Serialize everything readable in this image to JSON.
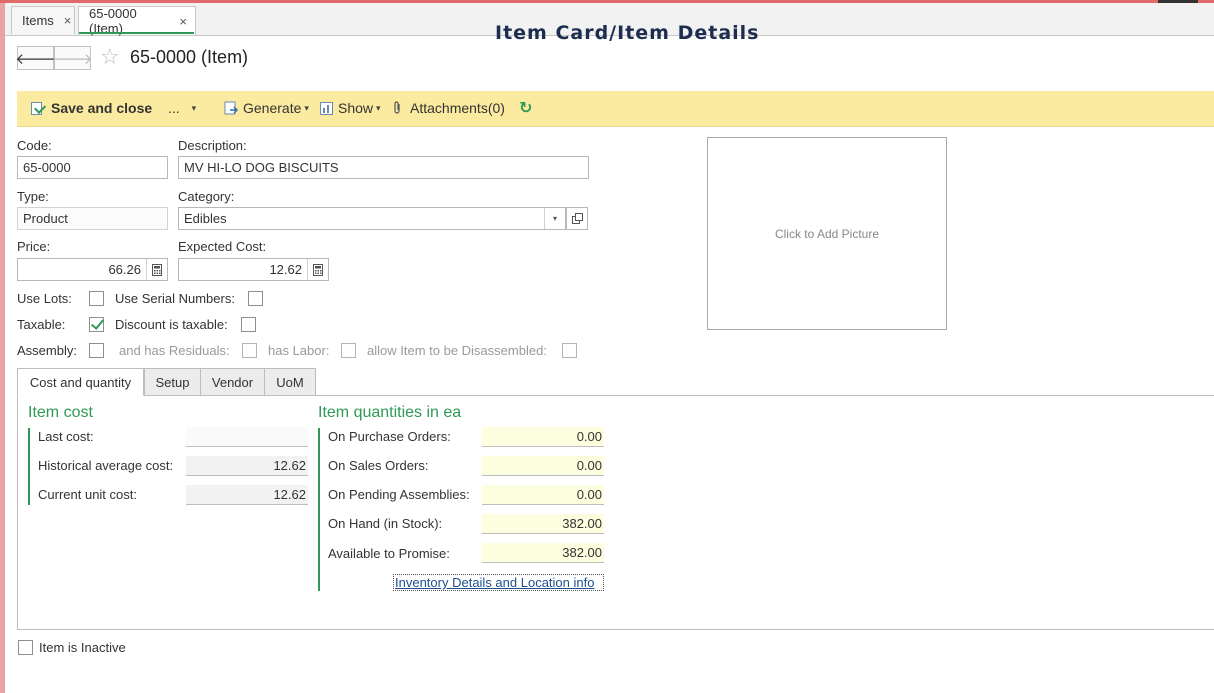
{
  "tabs": [
    {
      "label": "Items",
      "close": "×"
    },
    {
      "label": "65-0000 (Item)",
      "close": "×"
    }
  ],
  "overlay_title": "Item Card/Item Details",
  "nav": {
    "back": "🡐",
    "forward": "🡒",
    "star": "☆"
  },
  "page_title": "65-0000 (Item)",
  "toolbar": {
    "save_close": "Save and close",
    "more": "...",
    "generate": "Generate",
    "show": "Show",
    "attachments": "Attachments(0)",
    "refresh": "↻",
    "caret": "▾"
  },
  "form": {
    "code_label": "Code:",
    "code_value": "65-0000",
    "description_label": "Description:",
    "description_value": "MV HI-LO DOG BISCUITS",
    "type_label": "Type:",
    "type_value": "Product",
    "category_label": "Category:",
    "category_value": "Edibles",
    "price_label": "Price:",
    "price_value": "66.26",
    "expected_cost_label": "Expected Cost:",
    "expected_cost_value": "12.62",
    "use_lots_label": "Use Lots:",
    "use_serial_label": "Use Serial Numbers:",
    "taxable_label": "Taxable:",
    "discount_taxable_label": "Discount is taxable:",
    "assembly_label": "Assembly:",
    "has_residuals_label": "and has Residuals:",
    "has_labor_label": "has Labor:",
    "allow_disassembly_label": "allow Item to be Disassembled:",
    "checks": {
      "use_lots": false,
      "use_serial": false,
      "taxable": true,
      "discount_taxable": false,
      "assembly": false,
      "has_residuals": false,
      "has_labor": false,
      "allow_disassembly": false
    }
  },
  "picture_placeholder": "Click to Add Picture",
  "form_tabs": [
    "Cost and quantity",
    "Setup",
    "Vendor",
    "UoM"
  ],
  "item_cost": {
    "title": "Item cost",
    "rows": [
      {
        "label": "Last cost:",
        "value": ""
      },
      {
        "label": "Historical average cost:",
        "value": "12.62"
      },
      {
        "label": "Current unit cost:",
        "value": "12.62"
      }
    ]
  },
  "item_quantities": {
    "title": "Item quantities in ea",
    "rows": [
      {
        "label": "On Purchase Orders:",
        "value": "0.00"
      },
      {
        "label": "On Sales Orders:",
        "value": "0.00"
      },
      {
        "label": "On Pending Assemblies:",
        "value": "0.00"
      },
      {
        "label": "On Hand (in Stock):",
        "value": "382.00"
      },
      {
        "label": "Available to Promise:",
        "value": "382.00"
      }
    ],
    "link": "Inventory Details and Location info"
  },
  "inactive_label": "Item is Inactive"
}
